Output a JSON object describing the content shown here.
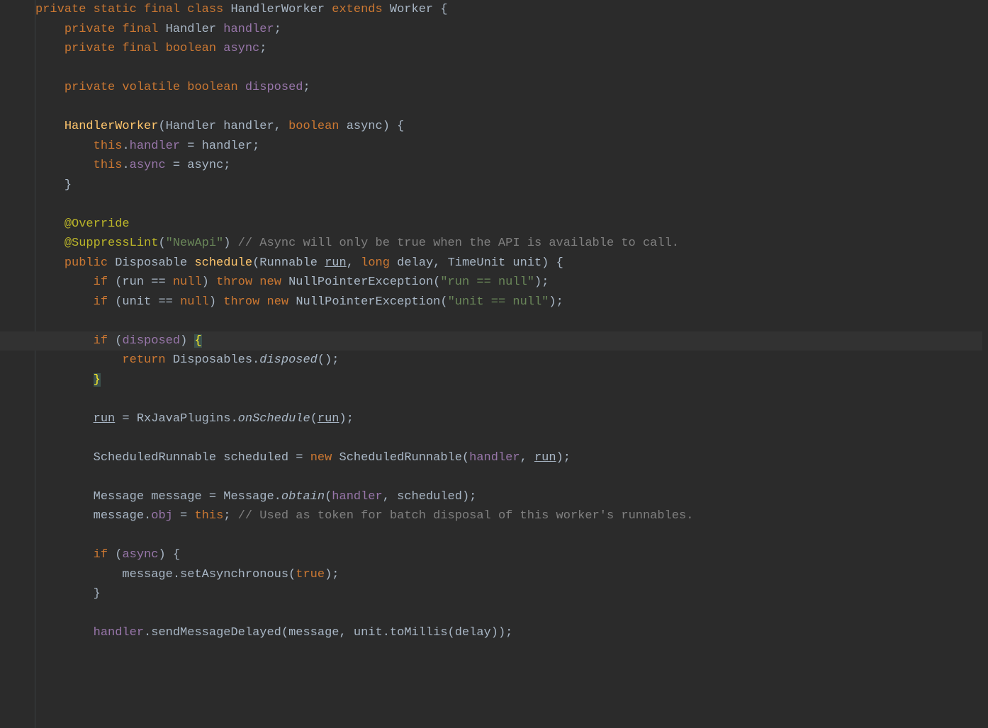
{
  "code": {
    "lines": [
      {
        "indent": 0,
        "segments": [
          {
            "t": "private static final class ",
            "c": "kw"
          },
          {
            "t": "HandlerWorker ",
            "c": "classname"
          },
          {
            "t": "extends ",
            "c": "kw"
          },
          {
            "t": "Worker {",
            "c": "classname"
          }
        ]
      },
      {
        "indent": 1,
        "segments": [
          {
            "t": "private final ",
            "c": "kw"
          },
          {
            "t": "Handler ",
            "c": "classname"
          },
          {
            "t": "handler",
            "c": "field"
          },
          {
            "t": ";",
            "c": "punct"
          }
        ]
      },
      {
        "indent": 1,
        "segments": [
          {
            "t": "private final boolean ",
            "c": "kw"
          },
          {
            "t": "async",
            "c": "field"
          },
          {
            "t": ";",
            "c": "punct"
          }
        ]
      },
      {
        "indent": 0,
        "segments": []
      },
      {
        "indent": 1,
        "segments": [
          {
            "t": "private volatile boolean ",
            "c": "kw"
          },
          {
            "t": "disposed",
            "c": "field"
          },
          {
            "t": ";",
            "c": "punct"
          }
        ]
      },
      {
        "indent": 0,
        "segments": []
      },
      {
        "indent": 1,
        "segments": [
          {
            "t": "HandlerWorker",
            "c": "method"
          },
          {
            "t": "(Handler handler",
            "c": "ident"
          },
          {
            "t": ", ",
            "c": "punct"
          },
          {
            "t": "boolean ",
            "c": "kw"
          },
          {
            "t": "async) {",
            "c": "ident"
          }
        ]
      },
      {
        "indent": 2,
        "segments": [
          {
            "t": "this",
            "c": "kw"
          },
          {
            "t": ".",
            "c": "punct"
          },
          {
            "t": "handler",
            "c": "field"
          },
          {
            "t": " = handler",
            "c": "ident"
          },
          {
            "t": ";",
            "c": "punct"
          }
        ]
      },
      {
        "indent": 2,
        "segments": [
          {
            "t": "this",
            "c": "kw"
          },
          {
            "t": ".",
            "c": "punct"
          },
          {
            "t": "async",
            "c": "field"
          },
          {
            "t": " = async",
            "c": "ident"
          },
          {
            "t": ";",
            "c": "punct"
          }
        ]
      },
      {
        "indent": 1,
        "segments": [
          {
            "t": "}",
            "c": "punct"
          }
        ]
      },
      {
        "indent": 0,
        "segments": []
      },
      {
        "indent": 1,
        "segments": [
          {
            "t": "@Override",
            "c": "anno"
          }
        ]
      },
      {
        "indent": 1,
        "segments": [
          {
            "t": "@SuppressLint",
            "c": "anno"
          },
          {
            "t": "(",
            "c": "punct"
          },
          {
            "t": "\"NewApi\"",
            "c": "string"
          },
          {
            "t": ") ",
            "c": "punct"
          },
          {
            "t": "// Async will only be true when the API is available to call.",
            "c": "comment"
          }
        ]
      },
      {
        "indent": 1,
        "segments": [
          {
            "t": "public ",
            "c": "kw"
          },
          {
            "t": "Disposable ",
            "c": "classname"
          },
          {
            "t": "schedule",
            "c": "method"
          },
          {
            "t": "(Runnable ",
            "c": "ident"
          },
          {
            "t": "run",
            "c": "param-underline"
          },
          {
            "t": ", ",
            "c": "punct"
          },
          {
            "t": "long ",
            "c": "kw"
          },
          {
            "t": "delay",
            "c": "ident"
          },
          {
            "t": ", ",
            "c": "punct"
          },
          {
            "t": "TimeUnit unit) {",
            "c": "ident"
          }
        ]
      },
      {
        "indent": 2,
        "segments": [
          {
            "t": "if ",
            "c": "kw"
          },
          {
            "t": "(run == ",
            "c": "ident"
          },
          {
            "t": "null",
            "c": "kw"
          },
          {
            "t": ") ",
            "c": "punct"
          },
          {
            "t": "throw new ",
            "c": "kw"
          },
          {
            "t": "NullPointerException(",
            "c": "ident"
          },
          {
            "t": "\"run == null\"",
            "c": "string"
          },
          {
            "t": ")",
            "c": "punct"
          },
          {
            "t": ";",
            "c": "punct"
          }
        ]
      },
      {
        "indent": 2,
        "segments": [
          {
            "t": "if ",
            "c": "kw"
          },
          {
            "t": "(unit == ",
            "c": "ident"
          },
          {
            "t": "null",
            "c": "kw"
          },
          {
            "t": ") ",
            "c": "punct"
          },
          {
            "t": "throw new ",
            "c": "kw"
          },
          {
            "t": "NullPointerException(",
            "c": "ident"
          },
          {
            "t": "\"unit == null\"",
            "c": "string"
          },
          {
            "t": ")",
            "c": "punct"
          },
          {
            "t": ";",
            "c": "punct"
          }
        ]
      },
      {
        "indent": 0,
        "segments": []
      },
      {
        "indent": 2,
        "highlight": true,
        "segments": [
          {
            "t": "if ",
            "c": "kw"
          },
          {
            "t": "(",
            "c": "punct"
          },
          {
            "t": "disposed",
            "c": "field"
          },
          {
            "t": ") ",
            "c": "punct"
          },
          {
            "t": "{",
            "c": "cursor-brace"
          }
        ]
      },
      {
        "indent": 3,
        "segments": [
          {
            "t": "return ",
            "c": "kw"
          },
          {
            "t": "Disposables.",
            "c": "ident"
          },
          {
            "t": "disposed",
            "c": "staticmethod"
          },
          {
            "t": "()",
            "c": "punct"
          },
          {
            "t": ";",
            "c": "punct"
          }
        ]
      },
      {
        "indent": 2,
        "segments": [
          {
            "t": "}",
            "c": "match-brace"
          }
        ]
      },
      {
        "indent": 0,
        "segments": []
      },
      {
        "indent": 2,
        "segments": [
          {
            "t": "run",
            "c": "param-underline"
          },
          {
            "t": " = RxJavaPlugins.",
            "c": "ident"
          },
          {
            "t": "onSchedule",
            "c": "staticmethod"
          },
          {
            "t": "(",
            "c": "punct"
          },
          {
            "t": "run",
            "c": "param-underline"
          },
          {
            "t": ")",
            "c": "punct"
          },
          {
            "t": ";",
            "c": "punct"
          }
        ]
      },
      {
        "indent": 0,
        "segments": []
      },
      {
        "indent": 2,
        "segments": [
          {
            "t": "ScheduledRunnable scheduled = ",
            "c": "ident"
          },
          {
            "t": "new ",
            "c": "kw"
          },
          {
            "t": "ScheduledRunnable(",
            "c": "ident"
          },
          {
            "t": "handler",
            "c": "field"
          },
          {
            "t": ", ",
            "c": "punct"
          },
          {
            "t": "run",
            "c": "param-underline"
          },
          {
            "t": ")",
            "c": "punct"
          },
          {
            "t": ";",
            "c": "punct"
          }
        ]
      },
      {
        "indent": 0,
        "segments": []
      },
      {
        "indent": 2,
        "segments": [
          {
            "t": "Message message = Message.",
            "c": "ident"
          },
          {
            "t": "obtain",
            "c": "staticmethod"
          },
          {
            "t": "(",
            "c": "punct"
          },
          {
            "t": "handler",
            "c": "field"
          },
          {
            "t": ", ",
            "c": "punct"
          },
          {
            "t": "scheduled)",
            "c": "ident"
          },
          {
            "t": ";",
            "c": "punct"
          }
        ]
      },
      {
        "indent": 2,
        "segments": [
          {
            "t": "message.",
            "c": "ident"
          },
          {
            "t": "obj",
            "c": "field"
          },
          {
            "t": " = ",
            "c": "punct"
          },
          {
            "t": "this",
            "c": "kw"
          },
          {
            "t": "; ",
            "c": "punct"
          },
          {
            "t": "// Used as token for batch disposal of this worker's runnables.",
            "c": "comment"
          }
        ]
      },
      {
        "indent": 0,
        "segments": []
      },
      {
        "indent": 2,
        "segments": [
          {
            "t": "if ",
            "c": "kw"
          },
          {
            "t": "(",
            "c": "punct"
          },
          {
            "t": "async",
            "c": "field"
          },
          {
            "t": ") {",
            "c": "punct"
          }
        ]
      },
      {
        "indent": 3,
        "segments": [
          {
            "t": "message.setAsynchronous(",
            "c": "ident"
          },
          {
            "t": "true",
            "c": "kw"
          },
          {
            "t": ")",
            "c": "punct"
          },
          {
            "t": ";",
            "c": "punct"
          }
        ]
      },
      {
        "indent": 2,
        "segments": [
          {
            "t": "}",
            "c": "punct"
          }
        ]
      },
      {
        "indent": 0,
        "segments": []
      },
      {
        "indent": 2,
        "segments": [
          {
            "t": "handler",
            "c": "field"
          },
          {
            "t": ".sendMessageDelayed(message",
            "c": "ident"
          },
          {
            "t": ", ",
            "c": "punct"
          },
          {
            "t": "unit.toMillis(delay))",
            "c": "ident"
          },
          {
            "t": ";",
            "c": "punct"
          }
        ]
      },
      {
        "indent": 0,
        "segments": []
      }
    ]
  },
  "cursor": {
    "line": 17,
    "col_char": "{"
  },
  "indent_unit": "    "
}
